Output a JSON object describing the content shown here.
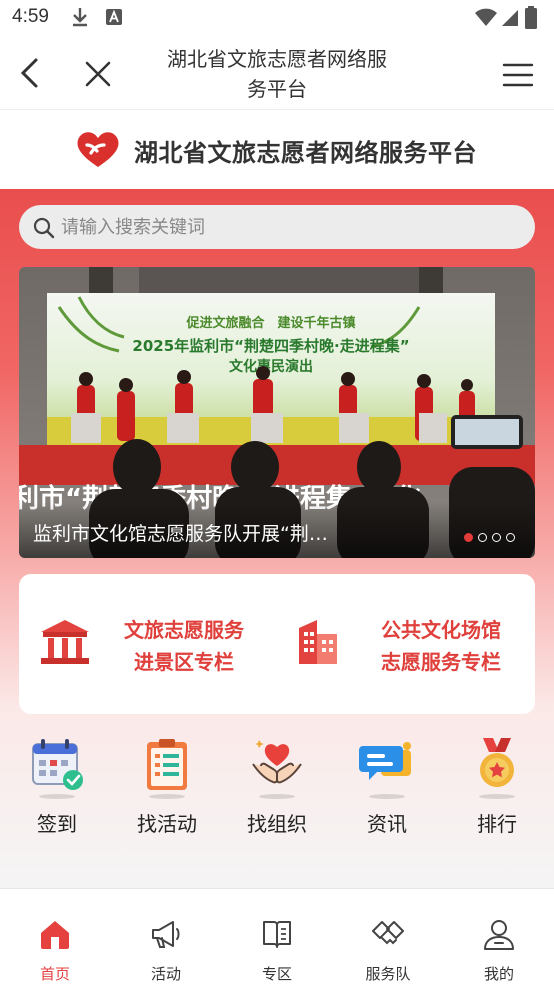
{
  "status_bar": {
    "time": "4:59"
  },
  "nav": {
    "title_line1": "湖北省文旅志愿者网络服",
    "title_line2": "务平台"
  },
  "brand": {
    "name": "湖北省文旅志愿者网络服务平台"
  },
  "search": {
    "placeholder": "请输入搜索关键词"
  },
  "carousel": {
    "caption": "监利市文化馆志愿服务队开展“荆…",
    "image_texts": {
      "slogan": "促进文旅融合　建设千年古镇",
      "banner_title": "2025年监利市“荆楚四季村晚·走进程集”",
      "banner_sub": "文化惠民演出",
      "foreground": "利市“荆楚四季村晚·走进程集”文化"
    },
    "slide_count": 4,
    "active_slide": 1
  },
  "columns": [
    {
      "line1": "文旅志愿服务",
      "line2": "进景区专栏",
      "icon": "pavilion-icon"
    },
    {
      "line1": "公共文化场馆",
      "line2": "志愿服务专栏",
      "icon": "building-icon"
    }
  ],
  "quick": [
    {
      "label": "签到",
      "icon": "calendar-check-icon"
    },
    {
      "label": "找活动",
      "icon": "clipboard-list-icon"
    },
    {
      "label": "找组织",
      "icon": "hands-heart-icon"
    },
    {
      "label": "资讯",
      "icon": "chat-bubble-icon"
    },
    {
      "label": "排行",
      "icon": "medal-icon"
    }
  ],
  "tabs": [
    {
      "label": "首页",
      "icon": "home-icon",
      "active": true
    },
    {
      "label": "活动",
      "icon": "megaphone-icon",
      "active": false
    },
    {
      "label": "专区",
      "icon": "book-icon",
      "active": false
    },
    {
      "label": "服务队",
      "icon": "handshake-icon",
      "active": false
    },
    {
      "label": "我的",
      "icon": "user-icon",
      "active": false
    }
  ],
  "colors": {
    "accent": "#e4413f",
    "hero_top": "#e94e4d"
  }
}
